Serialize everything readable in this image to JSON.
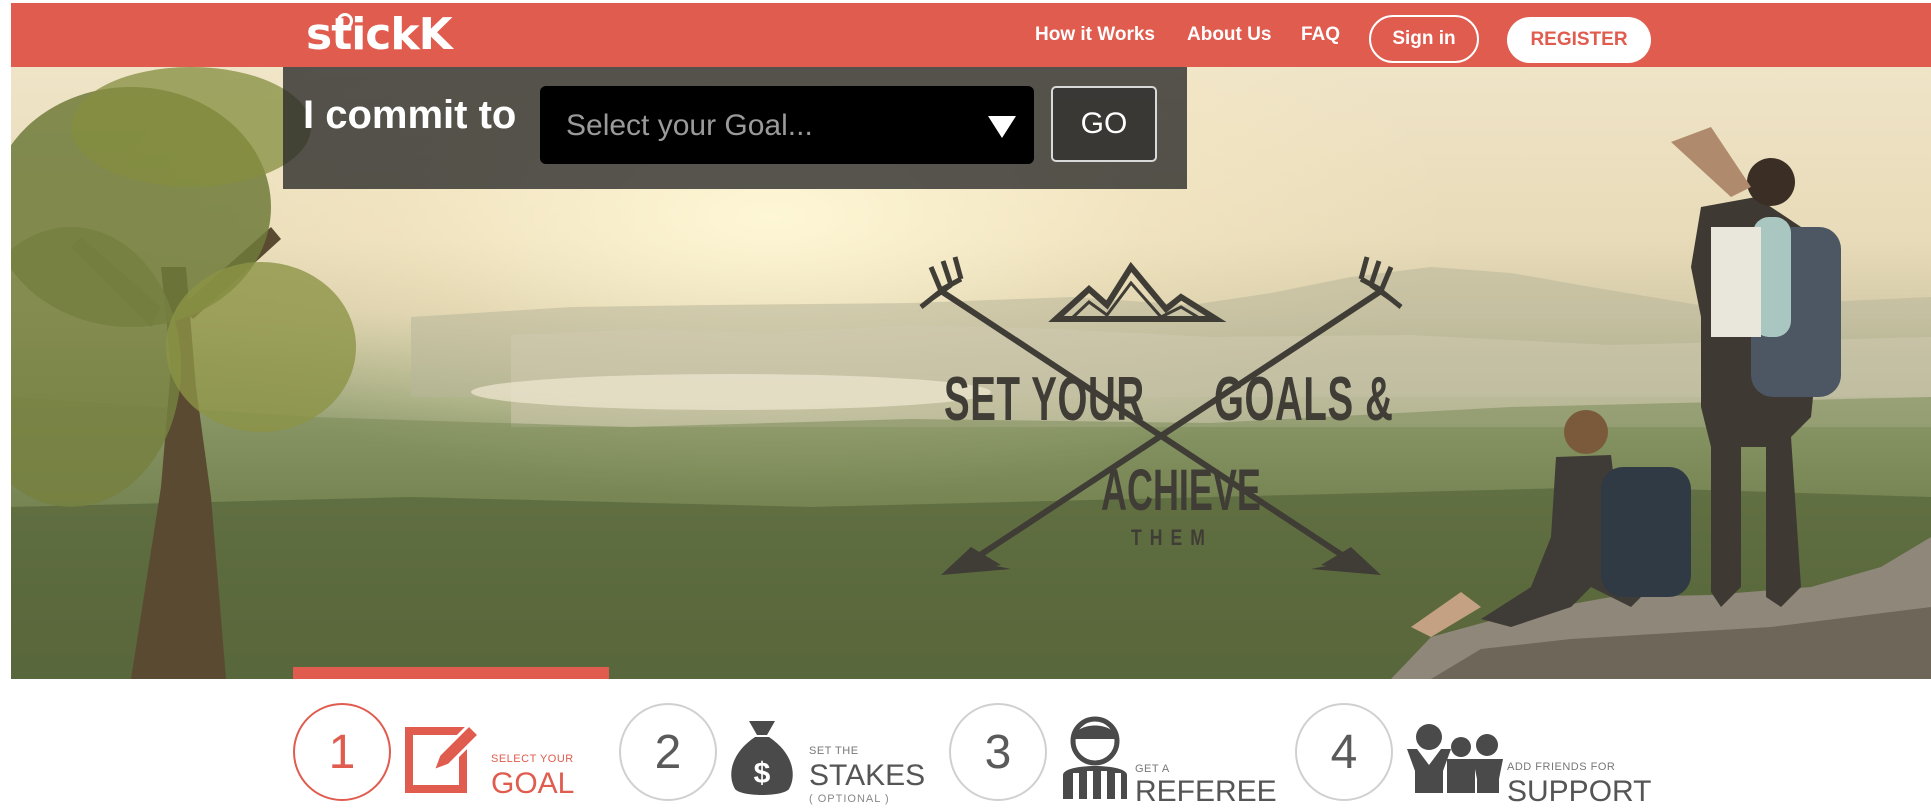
{
  "brand": {
    "logo_text": "stickK",
    "accent": "#e05c4f"
  },
  "nav": {
    "how": "How it Works",
    "about": "About Us",
    "faq": "FAQ",
    "signin": "Sign in",
    "register": "REGISTER"
  },
  "commit": {
    "label": "I commit to",
    "select_placeholder": "Select your Goal...",
    "go": "GO"
  },
  "emblem": {
    "line1": "SET YOUR",
    "line2": "GOALS &",
    "line3": "ACHIEVE",
    "line4": "THEM"
  },
  "steps": [
    {
      "number": "1",
      "small": "SELECT YOUR",
      "big": "GOAL",
      "icon": "edit-icon",
      "active": true
    },
    {
      "number": "2",
      "small": "SET THE",
      "big": "STAKES",
      "note": "( OPTIONAL )",
      "icon": "money-bag-icon",
      "active": false
    },
    {
      "number": "3",
      "small": "GET A",
      "big": "REFEREE",
      "icon": "referee-icon",
      "active": false
    },
    {
      "number": "4",
      "small": "ADD FRIENDS FOR",
      "big": "SUPPORT",
      "icon": "friends-icon",
      "active": false
    }
  ]
}
